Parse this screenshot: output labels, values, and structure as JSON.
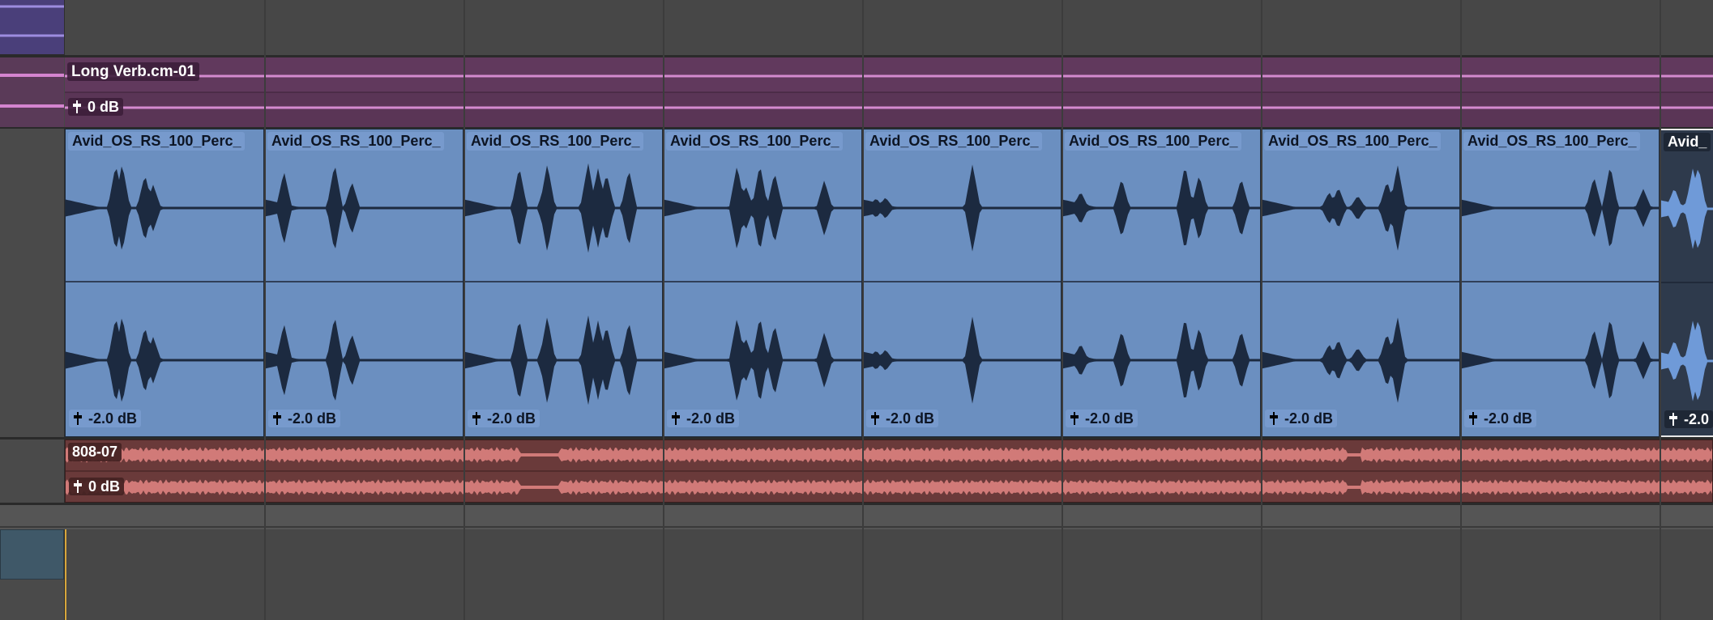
{
  "aux_track": {
    "clip_name": "Long Verb.cm-01",
    "gain": "0 dB",
    "color": "#7c4a78"
  },
  "perc_track": {
    "color": "#6b8fc0",
    "clips": [
      {
        "name": "Avid_OS_RS_100_Perc_",
        "gain": "-2.0 dB",
        "selected": true
      },
      {
        "name": "Avid_OS_RS_100_Perc_",
        "gain": "-2.0 dB",
        "selected": true
      },
      {
        "name": "Avid_OS_RS_100_Perc_",
        "gain": "-2.0 dB",
        "selected": true
      },
      {
        "name": "Avid_OS_RS_100_Perc_",
        "gain": "-2.0 dB",
        "selected": true
      },
      {
        "name": "Avid_OS_RS_100_Perc_",
        "gain": "-2.0 dB",
        "selected": true
      },
      {
        "name": "Avid_OS_RS_100_Perc_",
        "gain": "-2.0 dB",
        "selected": true
      },
      {
        "name": "Avid_OS_RS_100_Perc_",
        "gain": "-2.0 dB",
        "selected": true
      },
      {
        "name": "Avid_OS_RS_100_Perc_",
        "gain": "-2.0 dB",
        "selected": true
      },
      {
        "name": "Avid_",
        "gain": "-2.0",
        "selected": false
      }
    ]
  },
  "bass_track": {
    "clip_name": "808-07",
    "gain": "0 dB",
    "color": "#a75a5a"
  }
}
